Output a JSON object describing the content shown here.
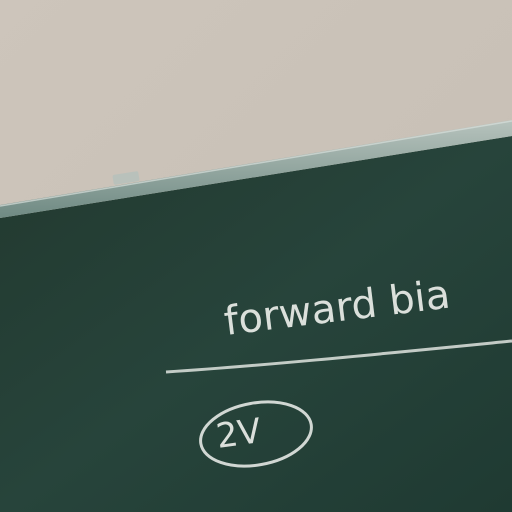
{
  "scene": {
    "description_colors": {
      "wall": "#cec6bc",
      "board": "#25403a",
      "frame": "#8aa39c",
      "chalk": "#e9ece8"
    }
  },
  "chalk": {
    "phrase": "forward bia",
    "circled_value": "2V"
  }
}
